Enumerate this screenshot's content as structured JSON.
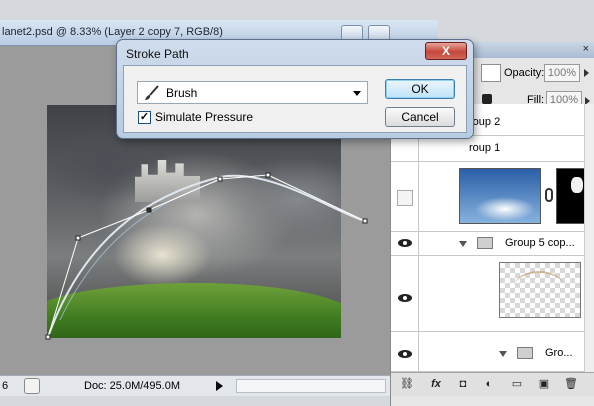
{
  "document": {
    "title": "lanet2.psd @ 8.33% (Layer 2 copy 7, RGB/8)",
    "status_zoom": "6",
    "doc_size": "Doc: 25.0M/495.0M"
  },
  "dialog": {
    "title": "Stroke Path",
    "close_label": "X",
    "tool_value": "Brush",
    "tool_icon": "brush-icon",
    "simulate_pressure_label": "Simulate Pressure",
    "simulate_pressure_checked": "✓",
    "ok_label": "OK",
    "cancel_label": "Cancel"
  },
  "layers_panel": {
    "close_label": "×",
    "opacity_label": "Opacity:",
    "opacity_value": "100%",
    "fill_label": "Fill:",
    "fill_value": "100%",
    "layers": [
      {
        "name": "roup 2"
      },
      {
        "name": "roup 1"
      },
      {
        "name": ""
      },
      {
        "name": "Group 5 cop..."
      },
      {
        "name": ""
      },
      {
        "name": "Gro..."
      }
    ],
    "footer_icons": [
      "link-icon",
      "fx-icon",
      "mask-icon",
      "adjustment-icon",
      "group-icon",
      "new-layer-icon",
      "trash-icon"
    ],
    "footer_labels": [
      "⛓",
      "fx",
      "◘",
      "◐",
      "▭",
      "▣",
      "🗑"
    ]
  },
  "colors": {
    "dialog_bg": "#cfdcec",
    "close_red": "#c4473a",
    "path_stroke": "#ffffff"
  }
}
